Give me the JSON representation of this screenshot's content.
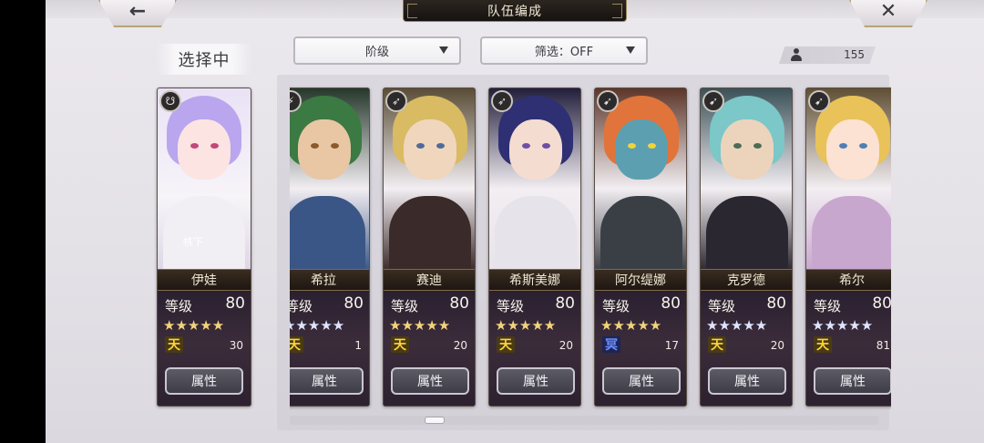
{
  "header": {
    "title": "队伍编成",
    "back_glyph": "←",
    "close_glyph": "✕"
  },
  "selection": {
    "label": "选择中"
  },
  "filters": {
    "rank_label": "阶级",
    "filter_label": "筛选：OFF"
  },
  "owned_count": "155",
  "selected_character": {
    "name": "伊娃",
    "level_label": "等级",
    "level": "80",
    "stars": "★★★★★",
    "element": "天",
    "number": "30",
    "attr_button": "属性",
    "badge": "☋",
    "caption": "帙下",
    "colors": {
      "hair": "#b9a6ee",
      "skin": "#fbe4e2",
      "body": "#f1eef4",
      "eye": "#c2477a"
    }
  },
  "characters": [
    {
      "name": "希拉",
      "level_label": "等级",
      "level": "80",
      "stars": "★★★★★",
      "element": "天",
      "number": "1",
      "attr_button": "属性",
      "badge": "⚡",
      "colors": {
        "hair": "#3b7a42",
        "skin": "#e9c7a4",
        "body": "#3a5686",
        "eye": "#8a5a2c"
      }
    },
    {
      "name": "赛迪",
      "level_label": "等级",
      "level": "80",
      "stars": "★★★★★",
      "element": "天",
      "number": "20",
      "attr_button": "属性",
      "badge": "➶",
      "colors": {
        "hair": "#d8bb63",
        "skin": "#f0d6bd",
        "body": "#3b2a2a",
        "eye": "#4e6a9a"
      }
    },
    {
      "name": "希斯美娜",
      "level_label": "等级",
      "level": "80",
      "stars": "★★★★★",
      "element": "天",
      "number": "20",
      "attr_button": "属性",
      "badge": "➶",
      "colors": {
        "hair": "#2f2f74",
        "skin": "#f4dcd0",
        "body": "#e7e3ea",
        "eye": "#6c4ea8"
      }
    },
    {
      "name": "阿尔缇娜",
      "level_label": "等级",
      "level": "80",
      "stars": "★★★★★",
      "element": "冥",
      "number": "17",
      "attr_button": "属性",
      "badge": "➹",
      "colors": {
        "hair": "#e0743a",
        "skin": "#5c9fb0",
        "body": "#3a3f45",
        "eye": "#f2d33c"
      }
    },
    {
      "name": "克罗德",
      "level_label": "等级",
      "level": "80",
      "stars": "★★★★★",
      "element": "天",
      "number": "20",
      "attr_button": "属性",
      "badge": "➹",
      "colors": {
        "hair": "#7cc7c7",
        "skin": "#ecd4bc",
        "body": "#2b2730",
        "eye": "#4c6c55"
      }
    },
    {
      "name": "希尔",
      "level_label": "等级",
      "level": "80",
      "stars": "★★★★★",
      "element": "天",
      "number": "81",
      "attr_button": "属性",
      "badge": "➹",
      "colors": {
        "hair": "#e9c25a",
        "skin": "#fbe2d2",
        "body": "#c8a7cf",
        "eye": "#4f7fb8"
      }
    }
  ],
  "star_colors": {
    "gold": "#f3d37a",
    "silver": "#dfe4ff"
  }
}
